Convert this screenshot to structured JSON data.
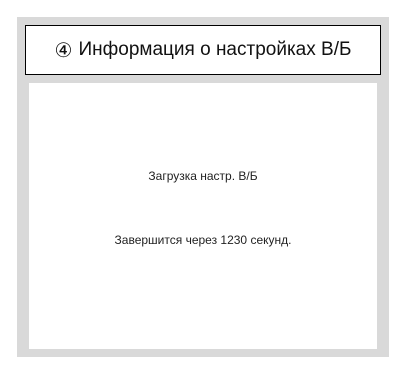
{
  "header": {
    "step_number": "④",
    "title": "Информация о настройках В/Б"
  },
  "main": {
    "status_text": "Загрузка настр. В/Б",
    "countdown_text": "Завершится через 1230 секунд."
  }
}
